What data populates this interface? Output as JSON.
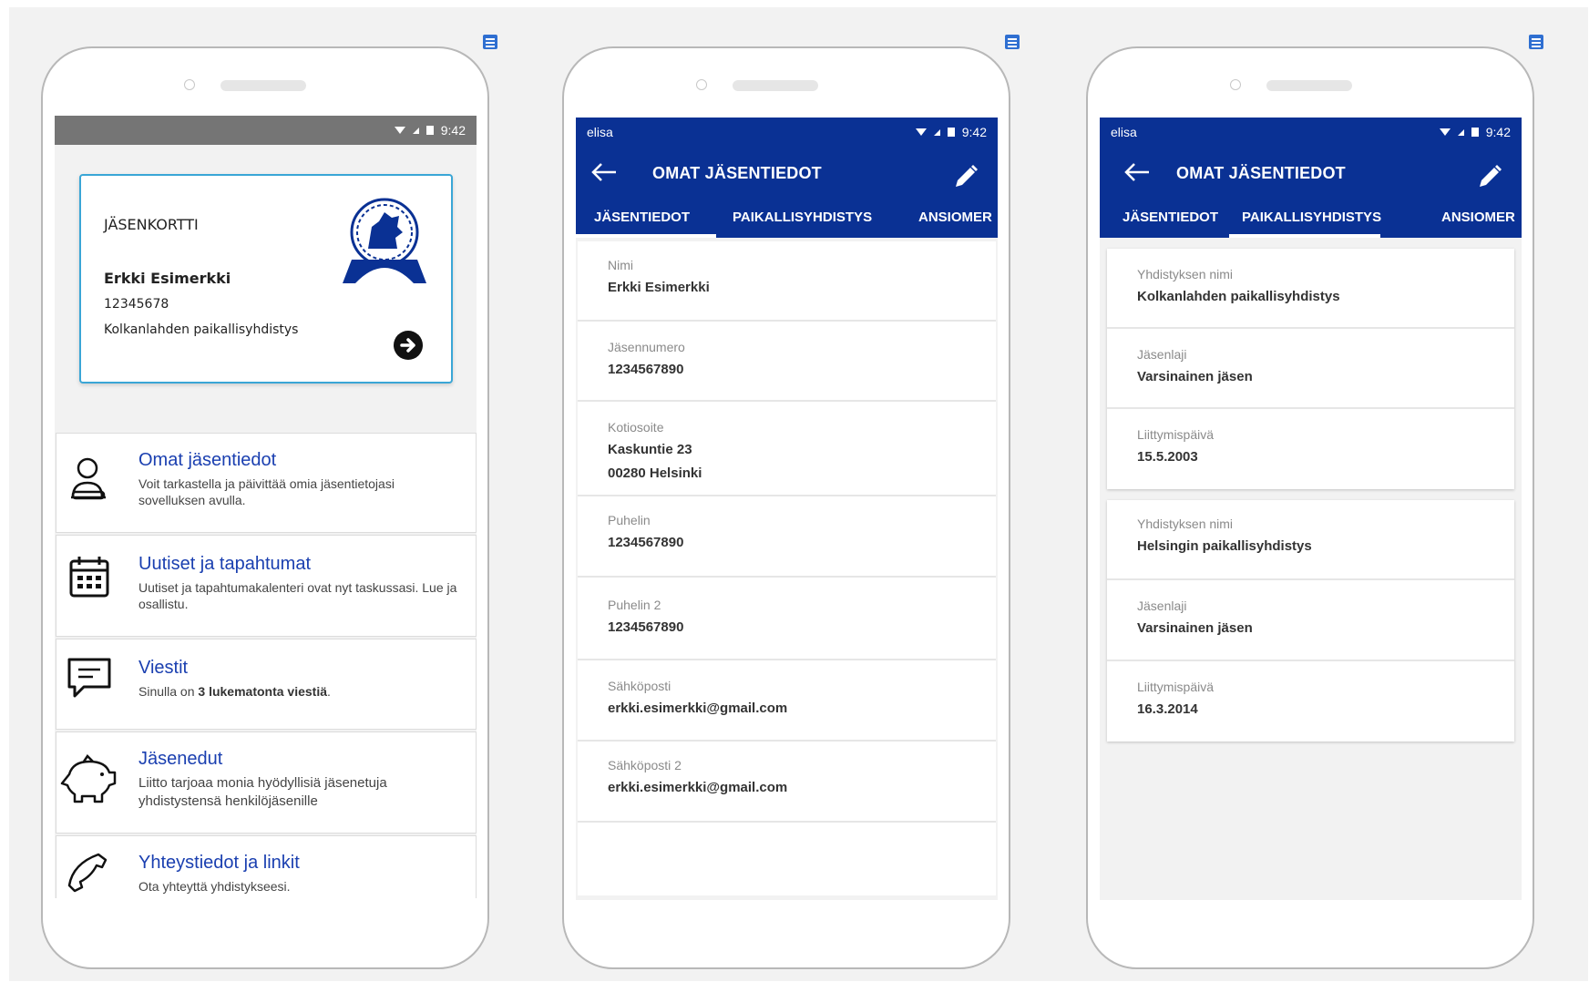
{
  "phone1": {
    "status_time": "9:42",
    "card": {
      "title": "JÄSENKORTTI",
      "name": "Erkki Esimerkki",
      "number": "12345678",
      "organization": "Kolkanlahden paikallisyhdistys"
    },
    "menu": [
      {
        "icon": "user-icon",
        "title": "Omat jäsentiedot",
        "desc": "Voit tarkastella ja päivittää omia jäsentietojasi sovelluksen avulla."
      },
      {
        "icon": "calendar-icon",
        "title": "Uutiset ja tapahtumat",
        "desc": "Uutiset ja tapahtumakalenteri ovat nyt taskussasi. Lue ja osallistu."
      },
      {
        "icon": "message-icon",
        "title": "Viestit",
        "desc_prefix": "Sinulla on ",
        "desc_bold": "3 lukematonta viestiä",
        "desc_suffix": "."
      },
      {
        "icon": "piggy-bank-icon",
        "title": "Jäsenedut",
        "desc": "Liitto tarjoaa monia hyödyllisiä jäsenetuja yhdistystensä henkilöjäsenille"
      },
      {
        "icon": "phone-icon",
        "title": "Yhteystiedot ja linkit",
        "desc": "Ota yhteyttä yhdistykseesi."
      }
    ]
  },
  "phone2": {
    "carrier": "elisa",
    "status_time": "9:42",
    "title": "OMAT JÄSENTIEDOT",
    "tabs": [
      "JÄSENTIEDOT",
      "PAIKALLISYHDISTYS",
      "ANSIOMER"
    ],
    "fields": [
      {
        "label": "Nimi",
        "value": "Erkki Esimerkki"
      },
      {
        "label": "Jäsennumero",
        "value": "1234567890"
      },
      {
        "label": "Kotiosoite",
        "value": "Kaskuntie 23",
        "value2": "00280 Helsinki"
      },
      {
        "label": "Puhelin",
        "value": "1234567890"
      },
      {
        "label": "Puhelin 2",
        "value": "1234567890"
      },
      {
        "label": "Sähköposti",
        "value": "erkki.esimerkki@gmail.com"
      },
      {
        "label": "Sähköposti 2",
        "value": "erkki.esimerkki@gmail.com"
      }
    ]
  },
  "phone3": {
    "carrier": "elisa",
    "status_time": "9:42",
    "title": "OMAT JÄSENTIEDOT",
    "tabs": [
      "JÄSENTIEDOT",
      "PAIKALLISYHDISTYS",
      "ANSIOMER"
    ],
    "groups": [
      [
        {
          "label": "Yhdistyksen nimi",
          "value": "Kolkanlahden paikallisyhdistys"
        },
        {
          "label": "Jäsenlaji",
          "value": "Varsinainen jäsen"
        },
        {
          "label": "Liittymispäivä",
          "value": "15.5.2003"
        }
      ],
      [
        {
          "label": "Yhdistyksen nimi",
          "value": "Helsingin paikallisyhdistys"
        },
        {
          "label": "Jäsenlaji",
          "value": "Varsinainen jäsen"
        },
        {
          "label": "Liittymispäivä",
          "value": "16.3.2014"
        }
      ]
    ]
  },
  "colors": {
    "primary": "#0a3194",
    "link": "#1a3fb0",
    "card_border": "#3aa6d6",
    "status_grey": "#757575"
  }
}
